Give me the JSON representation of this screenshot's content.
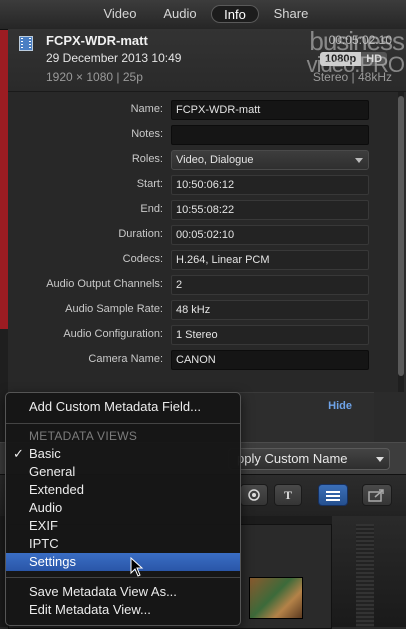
{
  "tabs": [
    {
      "label": "Video",
      "active": false
    },
    {
      "label": "Audio",
      "active": false
    },
    {
      "label": "Info",
      "active": true
    },
    {
      "label": "Share",
      "active": false
    }
  ],
  "clip": {
    "name": "FCPX-WDR-matt",
    "date": "29 December 2013 10:49",
    "format": "1920 × 1080  |  25p",
    "duration": "00:05:02:10",
    "resolution_badge": "1080p",
    "hd_badge": "HD",
    "audio": "Stereo  |  48kHz"
  },
  "fields": [
    {
      "label": "Name:",
      "value": "FCPX-WDR-matt",
      "style": "dark"
    },
    {
      "label": "Notes:",
      "value": "",
      "style": "dark"
    },
    {
      "label": "Roles:",
      "value": "Video, Dialogue",
      "style": "popup"
    },
    {
      "label": "Start:",
      "value": "10:50:06:12",
      "style": "plain"
    },
    {
      "label": "End:",
      "value": "10:55:08:22",
      "style": "plain"
    },
    {
      "label": "Duration:",
      "value": "00:05:02:10",
      "style": "plain"
    },
    {
      "label": "Codecs:",
      "value": "H.264, Linear PCM",
      "style": "plain"
    },
    {
      "label": "Audio Output Channels:",
      "value": "2",
      "style": "plain"
    },
    {
      "label": "Audio Sample Rate:",
      "value": "48 kHz",
      "style": "plain"
    },
    {
      "label": "Audio Configuration:",
      "value": "1 Stereo",
      "style": "plain"
    },
    {
      "label": "Camera Name:",
      "value": "CANON",
      "style": "dark"
    }
  ],
  "hide_label": "Hide",
  "custom_name_popup": "pply Custom Name",
  "toolbar": {
    "title_button": "T"
  },
  "watermark": {
    "line1": "business",
    "line2": "video.PRO"
  },
  "menu": {
    "add_custom": "Add Custom Metadata Field...",
    "views_header": "METADATA VIEWS",
    "views": [
      {
        "label": "Basic",
        "checked": true,
        "selected": false
      },
      {
        "label": "General",
        "checked": false,
        "selected": false
      },
      {
        "label": "Extended",
        "checked": false,
        "selected": false
      },
      {
        "label": "Audio",
        "checked": false,
        "selected": false
      },
      {
        "label": "EXIF",
        "checked": false,
        "selected": false
      },
      {
        "label": "IPTC",
        "checked": false,
        "selected": false
      },
      {
        "label": "Settings",
        "checked": false,
        "selected": true
      }
    ],
    "checkmark": "✓",
    "save_view": "Save Metadata View As...",
    "edit_view": "Edit Metadata View..."
  }
}
